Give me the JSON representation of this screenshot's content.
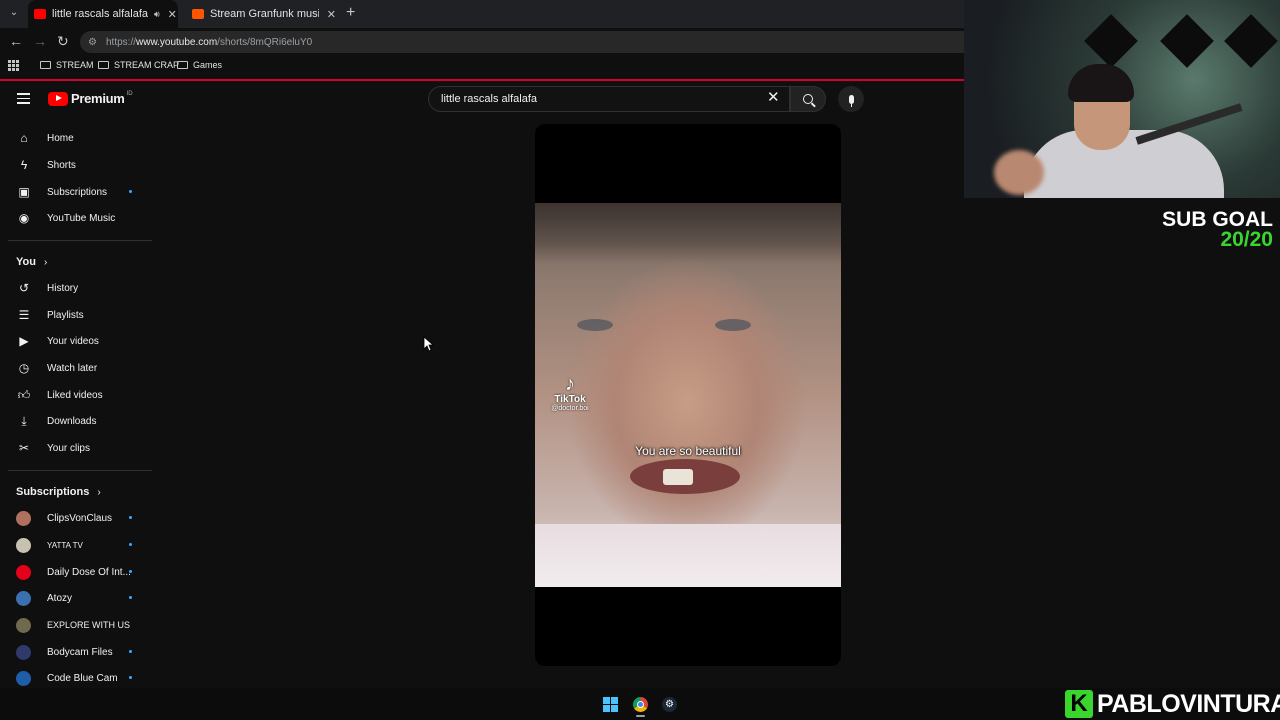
{
  "browser": {
    "tabs": [
      {
        "title": "little rascals alfalafa - YouTu",
        "favicon_color": "#ff0000",
        "active": true,
        "audio": true
      },
      {
        "title": "Stream Granfunk music | Listen",
        "favicon_color": "#ff5500",
        "active": false,
        "audio": false
      }
    ],
    "url_prefix": "https://",
    "url_domain": "www.youtube.com",
    "url_path": "/shorts/8mQRi6eluY0",
    "bookmarks": [
      "STREAM",
      "STREAM CRAP",
      "Games"
    ]
  },
  "header": {
    "logo_text": "Premium",
    "logo_sup": "ID",
    "search_value": "little rascals alfalafa",
    "accent": "#ff0000"
  },
  "sidebar": {
    "main": [
      {
        "label": "Home",
        "icon": "home-icon",
        "dot": false
      },
      {
        "label": "Shorts",
        "icon": "shorts-icon",
        "dot": false
      },
      {
        "label": "Subscriptions",
        "icon": "subscriptions-icon",
        "dot": true
      },
      {
        "label": "YouTube Music",
        "icon": "music-icon",
        "dot": false
      }
    ],
    "you_title": "You",
    "you": [
      {
        "label": "History",
        "icon": "history-icon"
      },
      {
        "label": "Playlists",
        "icon": "playlists-icon"
      },
      {
        "label": "Your videos",
        "icon": "your-videos-icon"
      },
      {
        "label": "Watch later",
        "icon": "watch-later-icon"
      },
      {
        "label": "Liked videos",
        "icon": "like-icon"
      },
      {
        "label": "Downloads",
        "icon": "download-icon"
      },
      {
        "label": "Your clips",
        "icon": "scissors-icon"
      }
    ],
    "subs_title": "Subscriptions",
    "subscriptions": [
      {
        "label": "ClipsVonClaus",
        "color": "#b07060"
      },
      {
        "label": "YATTA TV",
        "color": "#c7c2b0"
      },
      {
        "label": "Daily Dose Of Int...",
        "color": "#e4001b"
      },
      {
        "label": "Atozy",
        "color": "#3a6fb0"
      },
      {
        "label": "EXPLORE WITH US",
        "color": "#6f6a4e"
      },
      {
        "label": "Bodycam Files",
        "color": "#2f3a6b"
      },
      {
        "label": "Code Blue Cam",
        "color": "#1e5ea8"
      }
    ]
  },
  "video": {
    "tiktok_label": "TikTok",
    "tiktok_handle": "@doctor.boi",
    "caption": "You are so beautiful"
  },
  "overlay": {
    "sub_goal_label": "SUB GOAL",
    "sub_goal_value": "20/20",
    "goal_color": "#3ad62e",
    "brand_letter": "K",
    "brand_name": "PABLOVINTURA"
  }
}
